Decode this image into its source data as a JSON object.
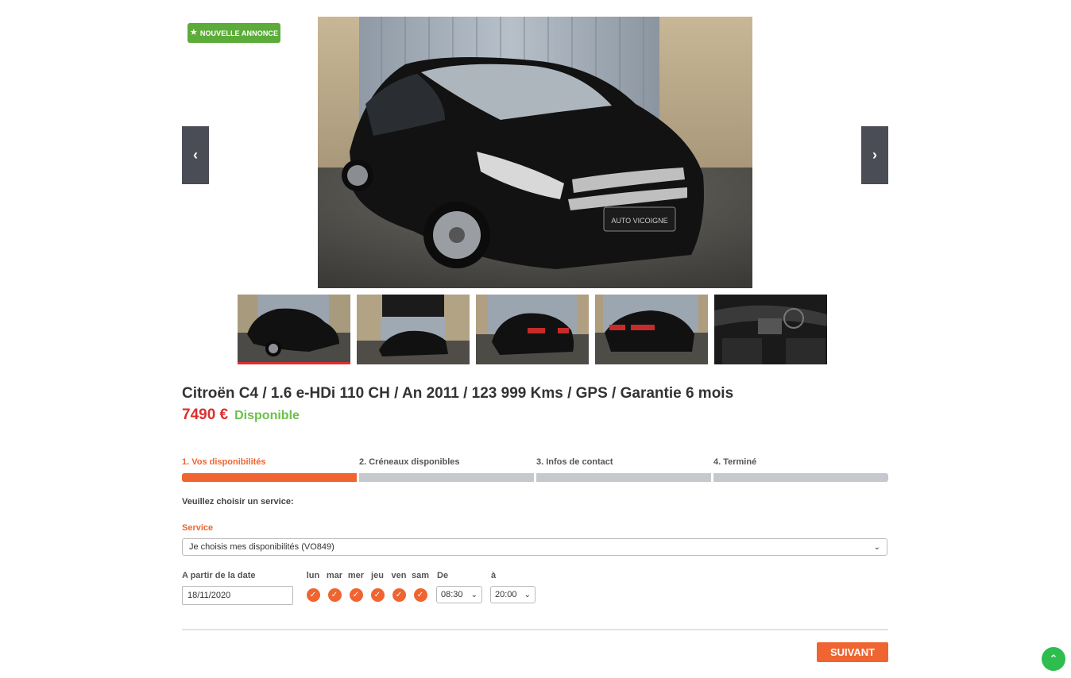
{
  "badge": {
    "label": "NOUVELLE ANNONCE",
    "icon": "star-icon"
  },
  "gallery": {
    "prev_icon": "chevron-left-icon",
    "next_icon": "chevron-right-icon",
    "thumbnails": [
      "front-three-quarter",
      "front-with-sign",
      "rear-three-quarter-right",
      "rear-three-quarter-left",
      "interior-dashboard"
    ],
    "active_index": 0,
    "plate_text": "AUTO VICOIGNE"
  },
  "listing": {
    "title": "Citroën C4 / 1.6 e-HDi 110 CH / An 2011 / 123 999 Kms / GPS / Garantie 6 mois",
    "price": "7490 €",
    "availability": "Disponible"
  },
  "steps": [
    {
      "label": "1. Vos disponibilités",
      "active": true
    },
    {
      "label": "2. Créneaux disponibles",
      "active": false
    },
    {
      "label": "3. Infos de contact",
      "active": false
    },
    {
      "label": "4. Terminé",
      "active": false
    }
  ],
  "form": {
    "service_question": "Veuillez choisir un service:",
    "service_label": "Service",
    "service_value": "Je choisis mes disponibilités (VO849)",
    "date_label": "A partir de la date",
    "date_value": "18/11/2020",
    "days": [
      "lun",
      "mar",
      "mer",
      "jeu",
      "ven",
      "sam"
    ],
    "from_label": "De",
    "from_value": "08:30",
    "to_label": "à",
    "to_value": "20:00"
  },
  "actions": {
    "next_label": "SUIVANT",
    "scroll_top_icon": "chevron-up-icon"
  },
  "colors": {
    "accent": "#ef6430",
    "price": "#d9312e",
    "available": "#6cc04a",
    "badge": "#5cac3a",
    "scroll_top": "#2ebd4e"
  }
}
